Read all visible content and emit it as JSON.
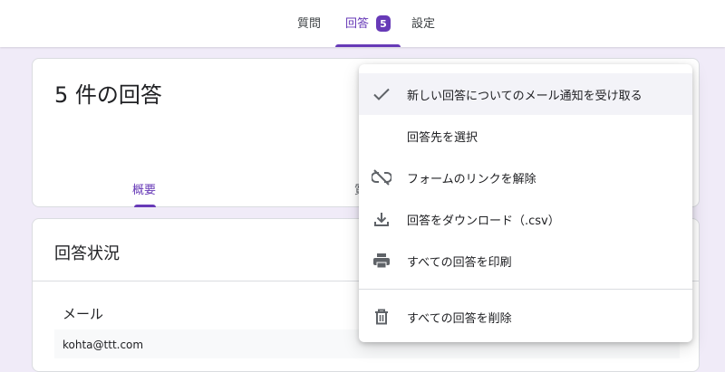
{
  "header": {
    "tabs": [
      {
        "label": "質問"
      },
      {
        "label": "回答",
        "badge": "5"
      },
      {
        "label": "設定"
      }
    ]
  },
  "summary": {
    "title": "5 件の回答",
    "subtabs": [
      "概要",
      "質"
    ]
  },
  "status": {
    "title": "回答状況",
    "field_label": "メール",
    "field_value": "kohta@ttt.com"
  },
  "menu": {
    "items": [
      {
        "label": "新しい回答についてのメール通知を受け取る",
        "icon": "check-icon"
      },
      {
        "label": "回答先を選択",
        "icon": ""
      },
      {
        "label": "フォームのリンクを解除",
        "icon": "unlink-icon"
      },
      {
        "label": "回答をダウンロード（.csv）",
        "icon": "download-icon"
      },
      {
        "label": "すべての回答を印刷",
        "icon": "print-icon"
      },
      {
        "label": "すべての回答を削除",
        "icon": "trash-icon"
      }
    ]
  },
  "colors": {
    "accent": "#673ab7",
    "background": "#f0ebf8",
    "icon": "#5f6368"
  }
}
